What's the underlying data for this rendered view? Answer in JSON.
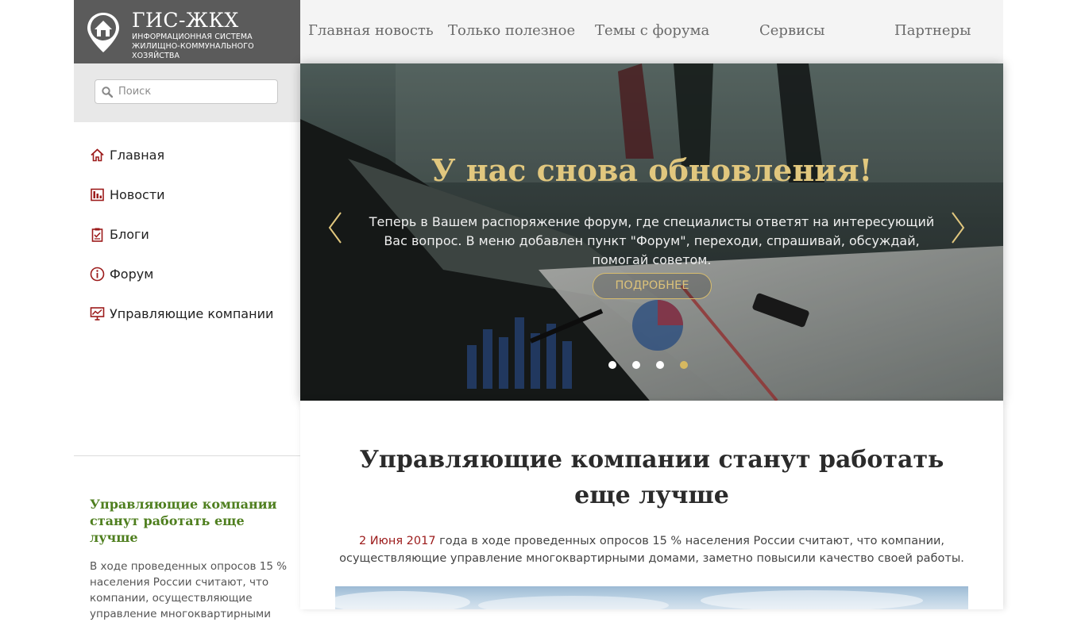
{
  "logo": {
    "brand": "ГИС-ЖКХ",
    "subtitle_line1": "ИНФОРМАЦИОННАЯ СИСТЕМА",
    "subtitle_line2": "ЖИЛИЩНО-КОММУНАЛЬНОГО ХОЗЯЙСТВА",
    "icon": "house-pin-icon"
  },
  "topnav": {
    "items": [
      {
        "label": "Главная новость"
      },
      {
        "label": "Только полезное"
      },
      {
        "label": "Темы с форума"
      },
      {
        "label": "Сервисы"
      },
      {
        "label": "Партнеры"
      }
    ]
  },
  "sidebar": {
    "search": {
      "placeholder": "Поиск",
      "value": "",
      "icon": "search-icon"
    },
    "items": [
      {
        "label": "Главная",
        "icon": "home-icon"
      },
      {
        "label": "Новости",
        "icon": "news-icon"
      },
      {
        "label": "Блоги",
        "icon": "clipboard-icon"
      },
      {
        "label": "Форум",
        "icon": "info-icon"
      },
      {
        "label": "Управляющие компании",
        "icon": "chart-monitor-icon"
      }
    ],
    "news": {
      "title": "Управляющие компании станут работать еще лучше",
      "text": "В ходе проведенных опросов 15 % населения России считают, что компании, осуществляющие управление многоквартирными"
    }
  },
  "hero": {
    "title": "У нас снова обновления!",
    "text": "Теперь в Вашем распоряжение форум, где специалисты ответят на интересующий Вас вопрос. В меню добавлен пункт \"Форум\", переходи, спрашивай, обсуждай, помогай советом.",
    "button": "ПОДРОБНЕЕ",
    "slides_total": 4,
    "active_slide": 4
  },
  "article": {
    "title": "Управляющие компании станут работать еще лучше",
    "date": "2 Июня 2017",
    "lead": " года в ходе проведенных опросов 15 % населения России считают, что компании, осуществляющие управление многоквартирными домами, заметно повысили качество своей работы."
  },
  "colors": {
    "logo_bg": "#5b5b5b",
    "nav_bg": "#f4f4f4",
    "icon_red": "#9c1b1b",
    "hero_gold": "#e1c77e",
    "sidebar_news_green": "#4f7f1f"
  }
}
